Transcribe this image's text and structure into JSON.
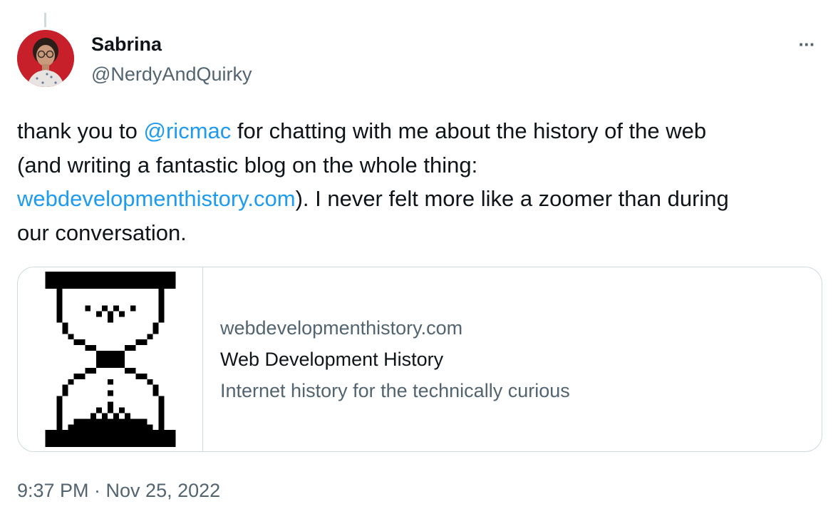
{
  "author": {
    "name": "Sabrina",
    "handle": "@NerdyAndQuirky"
  },
  "more_menu": {
    "label": "···",
    "icon": "more-horizontal-icon"
  },
  "tweet": {
    "seg1": "thank you to ",
    "mention": "@ricmac",
    "seg2": " for chatting with me about the history of the web",
    "seg3": "(and writing a fantastic blog on the whole thing:",
    "url": "webdevelopmenthistory.com",
    "seg4": "). I never felt more like a zoomer than during",
    "seg5": "our conversation."
  },
  "card": {
    "domain": "webdevelopmenthistory.com",
    "title": "Web Development History",
    "description": "Internet history for the technically curious",
    "image_icon": "hourglass-icon"
  },
  "timestamp": "9:37 PM · Nov 25, 2022",
  "colors": {
    "link": "#1d9bf0",
    "secondary_text": "#536471",
    "border": "#cfd9de",
    "avatar_background": "#c8202b"
  }
}
